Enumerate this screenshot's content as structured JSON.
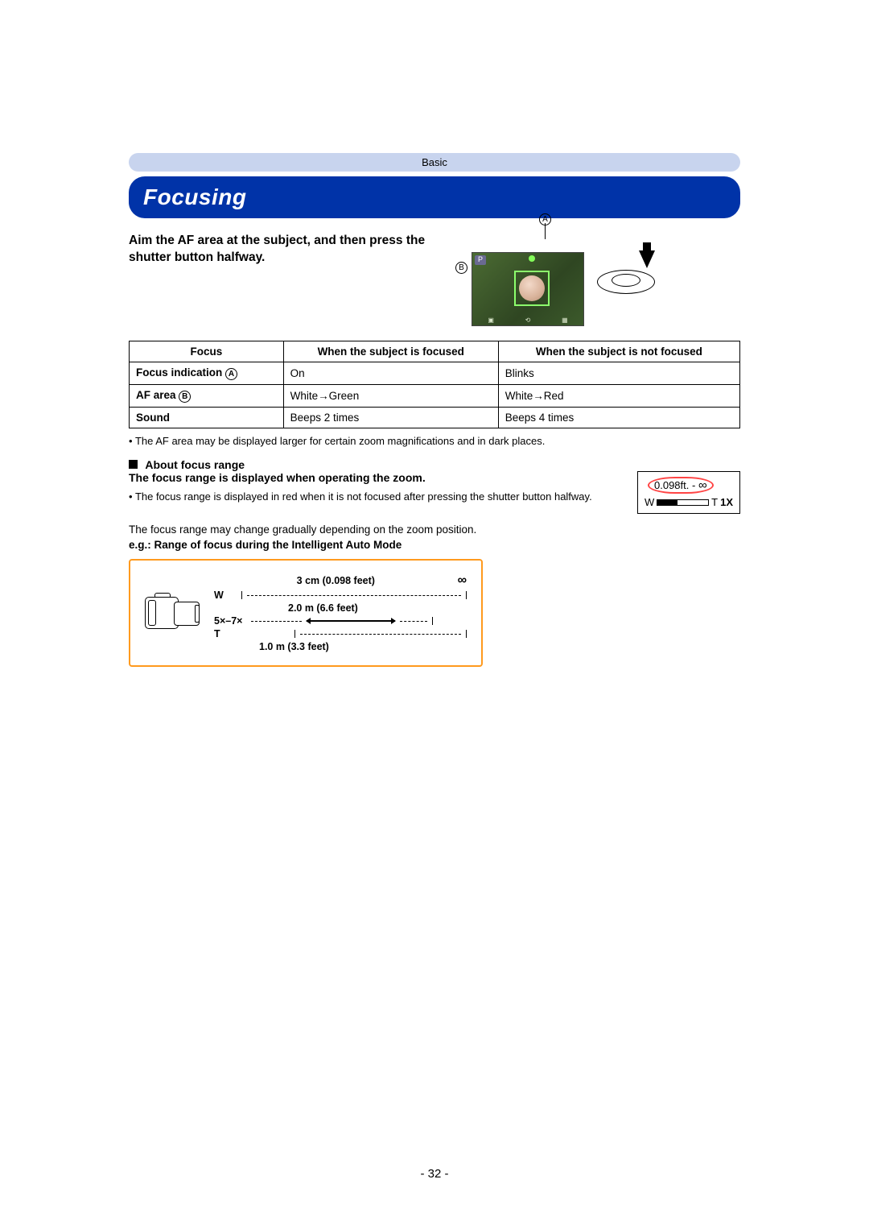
{
  "header": {
    "breadcrumb": "Basic",
    "title": "Focusing"
  },
  "lead": "Aim the AF area at the subject, and then press the shutter button halfway.",
  "labels": {
    "a": "A",
    "b": "B",
    "p": "P"
  },
  "table": {
    "head": [
      "Focus",
      "When the subject is focused",
      "When the subject is not focused"
    ],
    "rows": [
      {
        "col1_prefix": "Focus indication ",
        "col1_badge": "A",
        "c2": "On",
        "c3": "Blinks"
      },
      {
        "col1_prefix": "AF area ",
        "col1_badge": "B",
        "c2": "White→Green",
        "c3": "White→Red"
      },
      {
        "col1_prefix": "Sound",
        "col1_badge": "",
        "c2": "Beeps 2 times",
        "c3": "Beeps 4 times"
      }
    ]
  },
  "notes": {
    "after_table": "The AF area may be displayed larger for certain zoom magnifications and in dark places.",
    "red_note": "The focus range is displayed in red when it is not focused after pressing the shutter button halfway."
  },
  "focus_range": {
    "heading": "About focus range",
    "sub": "The focus range is displayed when operating the zoom.",
    "indicator": {
      "value": "0.098ft. -",
      "inf": "∞",
      "w": "W",
      "t": "T",
      "mag": "1X"
    },
    "gradual": "The focus range may change gradually depending on the zoom position.",
    "example": "e.g.: Range of focus during the Intelligent Auto Mode"
  },
  "chart_data": {
    "type": "table",
    "title": "Range of focus vs zoom (Intelligent Auto Mode)",
    "rows": [
      {
        "zoom": "W",
        "min": "3 cm (0.098 feet)",
        "max": "∞"
      },
      {
        "zoom": "5×–7×",
        "min": "2.0 m (6.6 feet)",
        "max": "∞"
      },
      {
        "zoom": "T",
        "min": "1.0 m (3.3 feet)",
        "max": "∞"
      }
    ],
    "labels": {
      "w": "W",
      "mid": "5×–7×",
      "t": "T",
      "d1": "3 cm (0.098 feet)",
      "d2": "2.0 m (6.6 feet)",
      "d3": "1.0 m (3.3 feet)",
      "inf": "∞"
    }
  },
  "page_number": "- 32 -"
}
